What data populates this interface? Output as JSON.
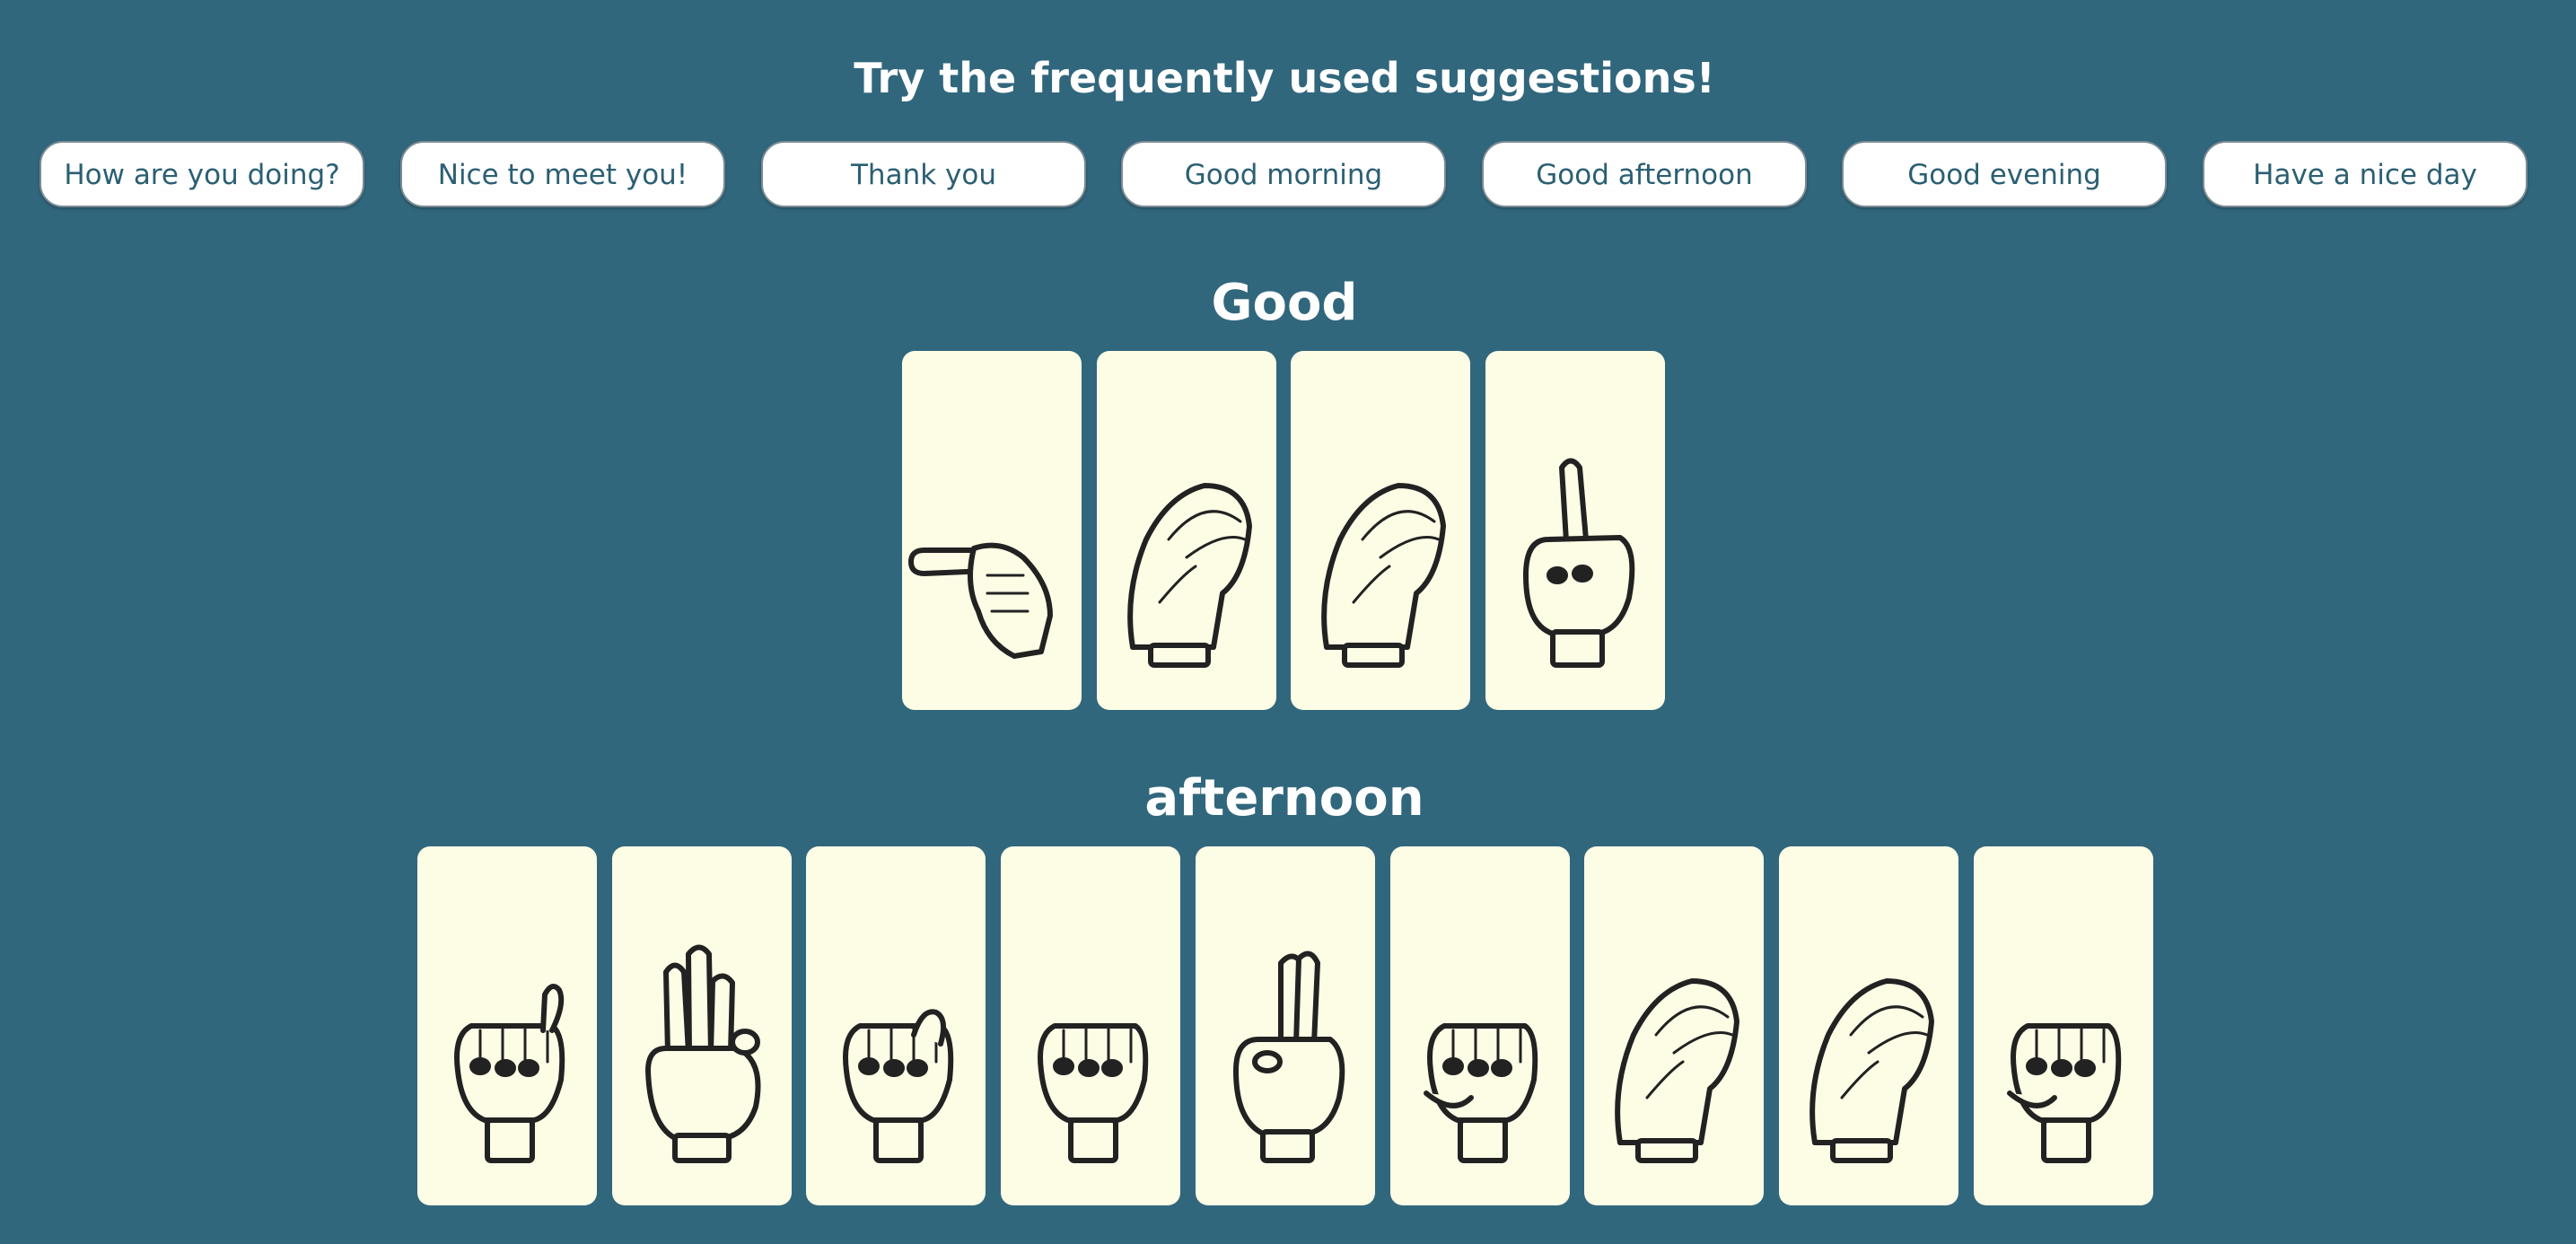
{
  "heading": "Try the frequently used suggestions!",
  "suggestions": [
    "How are you doing?",
    "Nice to meet you!",
    "Thank you",
    "Good morning",
    "Good afternoon",
    "Good evening",
    "Have a nice day"
  ],
  "words": [
    {
      "title": "Good",
      "signs": [
        {
          "letter": "G",
          "icon": "asl-g-hand-icon"
        },
        {
          "letter": "O",
          "icon": "asl-o-hand-icon"
        },
        {
          "letter": "O",
          "icon": "asl-o-hand-icon"
        },
        {
          "letter": "D",
          "icon": "asl-d-hand-icon"
        }
      ]
    },
    {
      "title": "afternoon",
      "signs": [
        {
          "letter": "A",
          "icon": "asl-a-hand-icon"
        },
        {
          "letter": "F",
          "icon": "asl-f-hand-icon"
        },
        {
          "letter": "T",
          "icon": "asl-t-hand-icon"
        },
        {
          "letter": "E",
          "icon": "asl-e-hand-icon"
        },
        {
          "letter": "R",
          "icon": "asl-r-hand-icon"
        },
        {
          "letter": "N",
          "icon": "asl-n-hand-icon"
        },
        {
          "letter": "O",
          "icon": "asl-o-hand-icon"
        },
        {
          "letter": "O",
          "icon": "asl-o-hand-icon"
        },
        {
          "letter": "N",
          "icon": "asl-n-hand-icon"
        }
      ]
    }
  ],
  "colors": {
    "background": "#31677d",
    "card": "#fdfde6",
    "chip_text": "#2b5f73",
    "chip_background": "#ffffff",
    "line_art": "#222222"
  }
}
